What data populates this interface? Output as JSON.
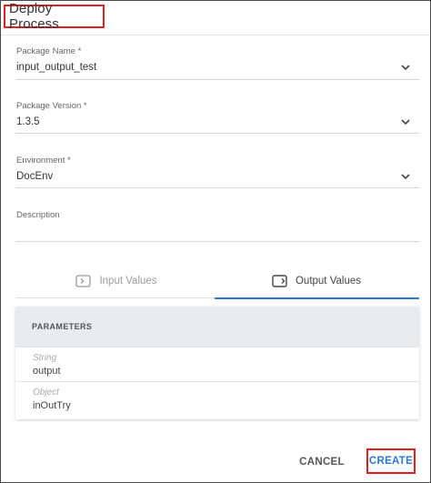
{
  "dialog": {
    "title": "Deploy Process"
  },
  "fields": {
    "package_name": {
      "label": "Package Name *",
      "value": "input_output_test"
    },
    "package_version": {
      "label": "Package Version *",
      "value": "1.3.5"
    },
    "environment": {
      "label": "Environment *",
      "value": "DocEnv"
    },
    "description": {
      "label": "Description",
      "value": ""
    }
  },
  "tabs": [
    {
      "label": "Input Values",
      "icon": "input-icon",
      "active": false
    },
    {
      "label": "Output Values",
      "icon": "output-icon",
      "active": true
    }
  ],
  "parameters": {
    "header": "PARAMETERS",
    "rows": [
      {
        "type": "String",
        "name": "output"
      },
      {
        "type": "Object",
        "name": "inOutTry"
      }
    ]
  },
  "actions": {
    "cancel_label": "CANCEL",
    "create_label": "CREATE"
  },
  "colors": {
    "accent": "#2a7ad5",
    "highlight_box": "#e02020"
  }
}
